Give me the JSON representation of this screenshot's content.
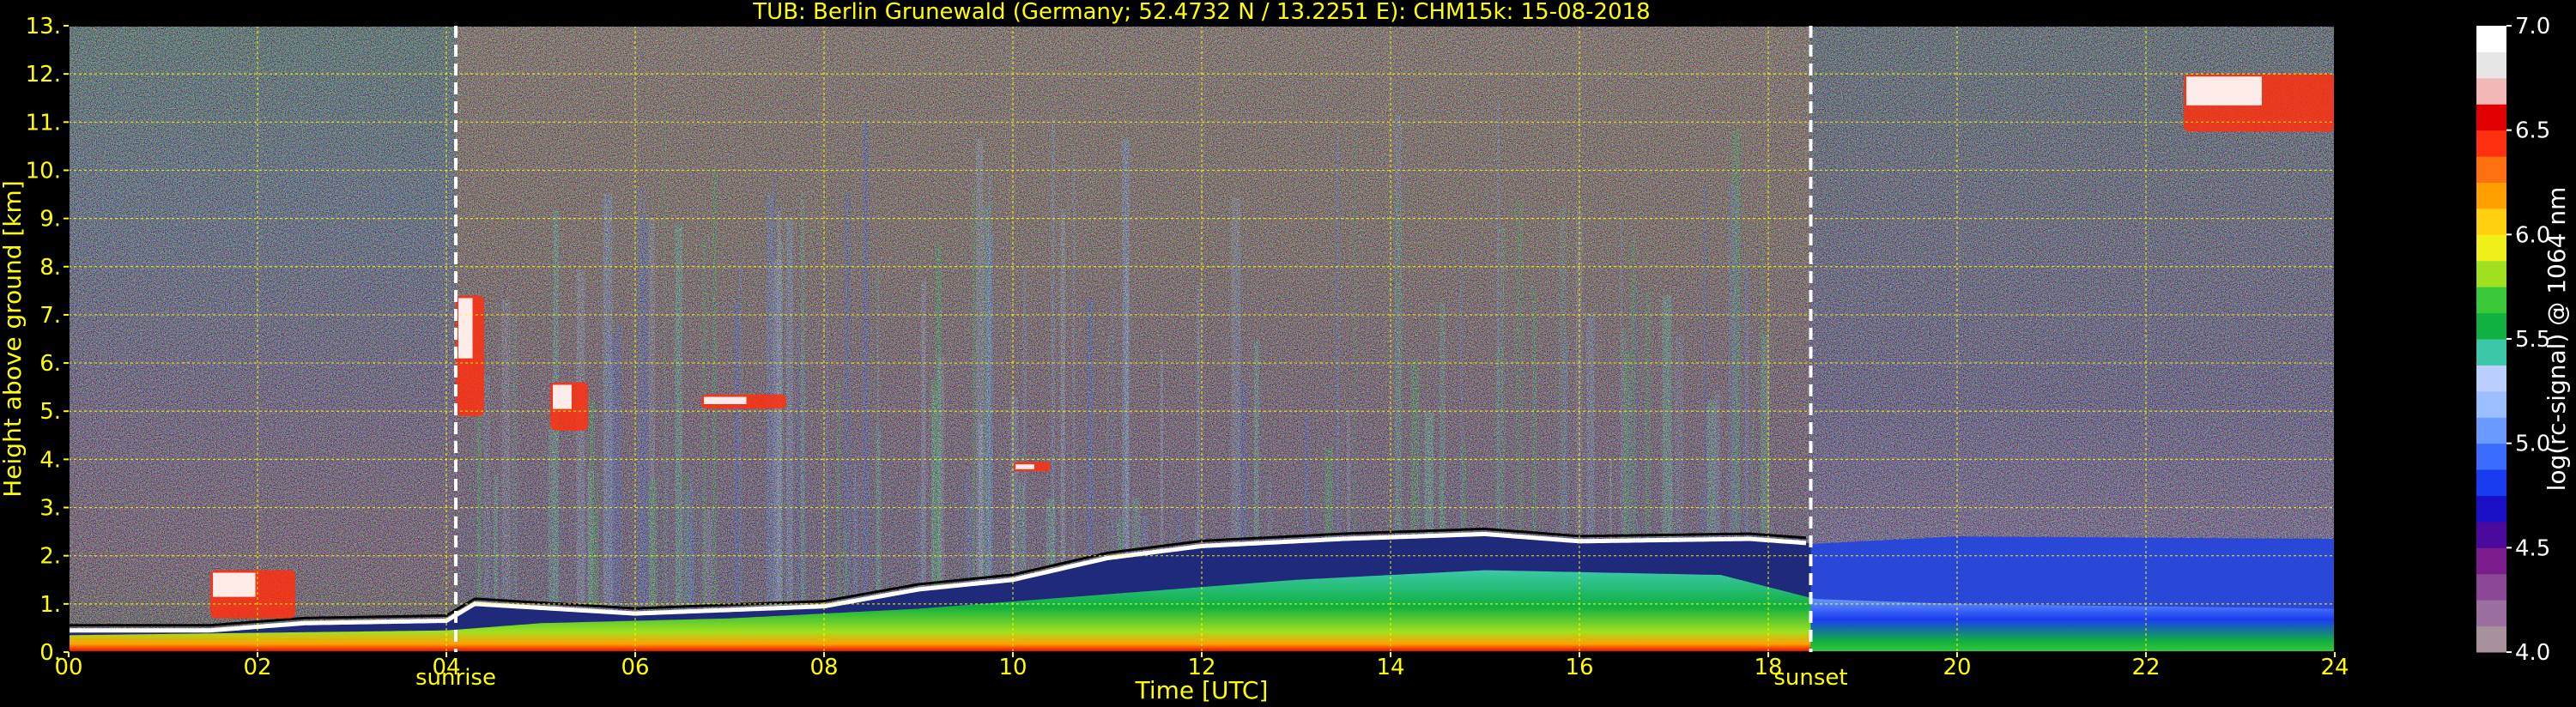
{
  "chart_data": {
    "type": "heatmap",
    "title": "TUB: Berlin Grunewald (Germany; 52.4732 N / 13.2251 E):    CHM15k: 15-08-2018",
    "xlabel": "Time [UTC]",
    "ylabel": "Height above ground [km]",
    "xlim": [
      0,
      24
    ],
    "ylim": [
      0,
      13
    ],
    "x_ticks": [
      "00",
      "02",
      "04",
      "06",
      "08",
      "10",
      "12",
      "14",
      "16",
      "18",
      "20",
      "22",
      "24"
    ],
    "y_ticks": [
      "0.",
      "1.",
      "2.",
      "3.",
      "4.",
      "5.",
      "6.",
      "7.",
      "8.",
      "9.",
      "10.",
      "11.",
      "12.",
      "13."
    ],
    "grid": true,
    "grid_color": "#ffff00",
    "axis_text_color": "#ffff00",
    "background": "#000000",
    "events": [
      {
        "label": "sunrise",
        "time": 4.1
      },
      {
        "label": "sunset",
        "time": 18.45
      }
    ],
    "colorbar": {
      "label": "log(rc-signal) @ 1064 nm",
      "range": [
        4.0,
        7.0
      ],
      "ticks": [
        "4.0",
        "4.5",
        "5.0",
        "5.5",
        "6.0",
        "6.5",
        "7.0"
      ],
      "colors": [
        "#a8909c",
        "#9b6f9f",
        "#8a4896",
        "#7a1c8c",
        "#4a0a9c",
        "#1a10c8",
        "#1a3cf0",
        "#3a6cff",
        "#6a9cff",
        "#9cc0ff",
        "#bcd0ff",
        "#3cc8a8",
        "#10b040",
        "#38c838",
        "#a0e020",
        "#f0f018",
        "#ffd010",
        "#ffa000",
        "#ff7010",
        "#ff3010",
        "#e00000",
        "#f2b8b8",
        "#e6e6e6",
        "#ffffff"
      ]
    },
    "layers": {
      "boundary_layer_top_km": [
        {
          "t": 0.0,
          "h": 0.45
        },
        {
          "t": 1.5,
          "h": 0.45
        },
        {
          "t": 2.5,
          "h": 0.6
        },
        {
          "t": 4.0,
          "h": 0.65
        },
        {
          "t": 4.3,
          "h": 1.0
        },
        {
          "t": 6.0,
          "h": 0.8
        },
        {
          "t": 8.0,
          "h": 0.95
        },
        {
          "t": 9.0,
          "h": 1.3
        },
        {
          "t": 10.0,
          "h": 1.5
        },
        {
          "t": 11.0,
          "h": 1.95
        },
        {
          "t": 12.0,
          "h": 2.2
        },
        {
          "t": 13.5,
          "h": 2.35
        },
        {
          "t": 15.0,
          "h": 2.45
        },
        {
          "t": 16.0,
          "h": 2.3
        },
        {
          "t": 17.8,
          "h": 2.35
        },
        {
          "t": 18.5,
          "h": 2.25
        },
        {
          "t": 20.0,
          "h": 2.4
        },
        {
          "t": 24.0,
          "h": 2.35
        }
      ],
      "mixed_layer_top_km": [
        {
          "t": 0.0,
          "h": 0.35
        },
        {
          "t": 4.0,
          "h": 0.45
        },
        {
          "t": 5.0,
          "h": 0.6
        },
        {
          "t": 7.0,
          "h": 0.7
        },
        {
          "t": 9.0,
          "h": 0.9
        },
        {
          "t": 11.0,
          "h": 1.2
        },
        {
          "t": 13.0,
          "h": 1.5
        },
        {
          "t": 15.0,
          "h": 1.7
        },
        {
          "t": 17.5,
          "h": 1.6
        },
        {
          "t": 18.5,
          "h": 1.1
        },
        {
          "t": 20.0,
          "h": 1.0
        },
        {
          "t": 24.0,
          "h": 0.9
        }
      ],
      "cloud_patches": [
        {
          "t0": 1.5,
          "t1": 2.4,
          "h0": 0.7,
          "h1": 1.7
        },
        {
          "t0": 4.1,
          "t1": 4.4,
          "h0": 4.9,
          "h1": 7.4
        },
        {
          "t0": 5.1,
          "t1": 5.5,
          "h0": 4.6,
          "h1": 5.6
        },
        {
          "t0": 6.7,
          "t1": 7.6,
          "h0": 5.05,
          "h1": 5.35
        },
        {
          "t0": 10.0,
          "t1": 10.4,
          "h0": 3.75,
          "h1": 3.95
        },
        {
          "t0": 22.4,
          "t1": 24.0,
          "h0": 10.8,
          "h1": 12.0
        }
      ]
    }
  }
}
